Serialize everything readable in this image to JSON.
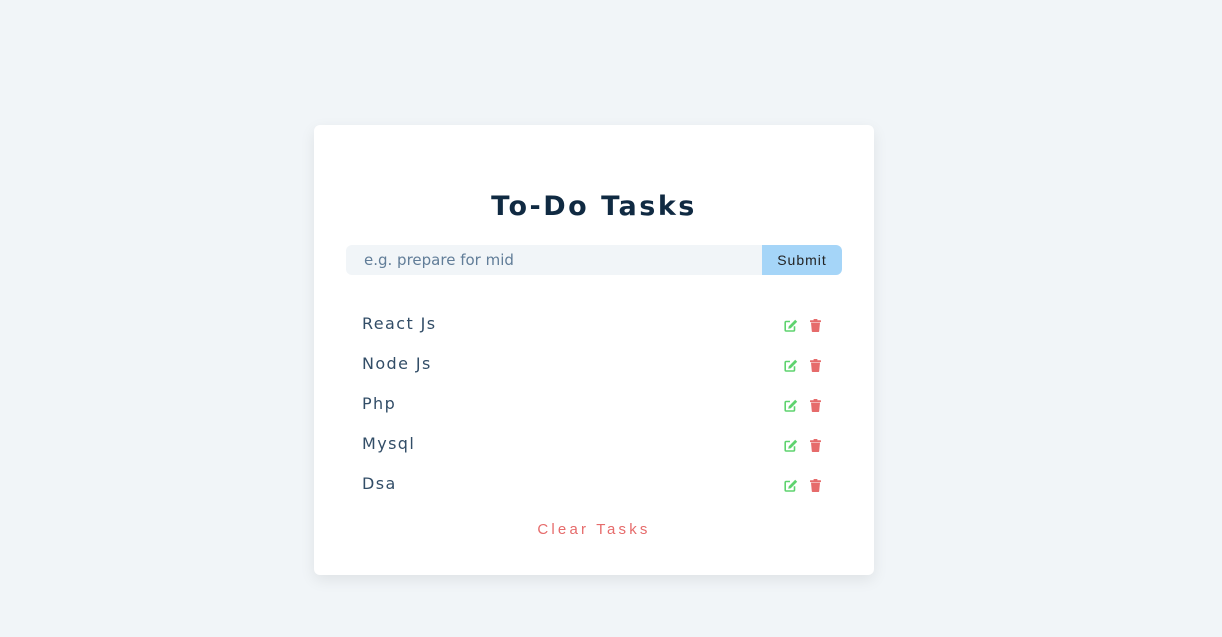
{
  "app": {
    "title": "To-Do Tasks"
  },
  "form": {
    "placeholder": "e.g. prepare for mid",
    "value": "",
    "submit_label": "Submit"
  },
  "tasks": [
    {
      "title": "React Js",
      "edit_icon": "edit-icon",
      "delete_icon": "trash-icon"
    },
    {
      "title": "Node Js",
      "edit_icon": "edit-icon",
      "delete_icon": "trash-icon"
    },
    {
      "title": "Php",
      "edit_icon": "edit-icon",
      "delete_icon": "trash-icon"
    },
    {
      "title": "Mysql",
      "edit_icon": "edit-icon",
      "delete_icon": "trash-icon"
    },
    {
      "title": "Dsa",
      "edit_icon": "edit-icon",
      "delete_icon": "trash-icon"
    }
  ],
  "clear_label": "Clear Tasks",
  "colors": {
    "background": "#f1f5f8",
    "title": "#102a42",
    "submit": "#a5d5f8",
    "edit": "#5ed36e",
    "delete": "#e66b6b",
    "clear": "#e66b6b"
  }
}
